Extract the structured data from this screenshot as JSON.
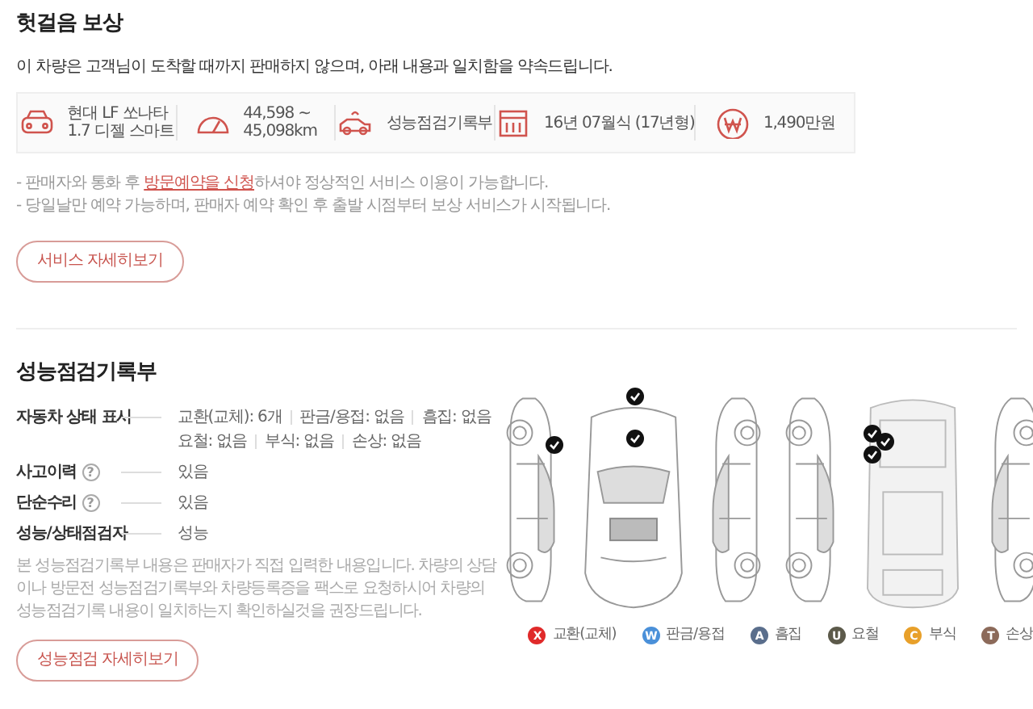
{
  "compensation": {
    "title": "헛걸음 보상",
    "intro": "이 차량은 고객님이 도착할 때까지 판매하지 않으며, 아래 내용과 일치함을 약속드립니다.",
    "info": [
      {
        "kind": "car",
        "lines": [
          "현대 LF 쏘나타",
          "1.7 디젤 스마트"
        ]
      },
      {
        "kind": "gauge",
        "lines": [
          "44,598 ~",
          "45,098km"
        ]
      },
      {
        "kind": "record",
        "lines": [
          "성능점검기록부"
        ]
      },
      {
        "kind": "calendar",
        "lines": [
          "16년 07월식 (17년형)"
        ]
      },
      {
        "kind": "price",
        "lines": [
          "1,490만원"
        ]
      }
    ],
    "notes": [
      {
        "before": "- 판매자와 통화 후 ",
        "link": "방문예약을 신청",
        "after": "하셔야 정상적인 서비스 이용이 가능합니다."
      },
      {
        "before": "- 당일날만 예약 가능하며, 판매자 예약 확인 후 출발 시점부터 보상 서비스가 시작됩니다."
      }
    ],
    "button": "서비스 자세히보기"
  },
  "inspection": {
    "title": "성능점검기록부",
    "rows": [
      {
        "label": "자동차 상태 표시",
        "help": false,
        "values": [
          [
            "교환(교체): 6개",
            "판금/용접: 없음",
            "흠집: 없음"
          ],
          [
            "요철: 없음",
            "부식: 없음",
            "손상: 없음"
          ]
        ]
      },
      {
        "label": "사고이력",
        "help": true,
        "values": [
          [
            "있음"
          ]
        ]
      },
      {
        "label": "단순수리",
        "help": true,
        "values": [
          [
            "있음"
          ]
        ]
      },
      {
        "label": "성능/상태점검자",
        "help": false,
        "values": [
          [
            "성능"
          ]
        ]
      }
    ],
    "note": "본 성능점검기록부 내용은 판매자가 직접 입력한 내용입니다. 차량의 상담이나 방문전 성능점검기록부와 차량등록증을 팩스로 요청하시어 차량의 성능점검기록 내용이 일치하는지 확인하실것을 권장드립니다.",
    "button": "성능점검 자세히보기",
    "help_mark": "?",
    "legend": [
      {
        "letter": "X",
        "label": "교환(교체)",
        "color": "#e02a2a"
      },
      {
        "letter": "W",
        "label": "판금/용접",
        "color": "#4a90d9"
      },
      {
        "letter": "A",
        "label": "흠집",
        "color": "#5a6e8c"
      },
      {
        "letter": "U",
        "label": "요철",
        "color": "#5c5a4a"
      },
      {
        "letter": "C",
        "label": "부식",
        "color": "#e8a02a"
      },
      {
        "letter": "T",
        "label": "손상",
        "color": "#8c6a5a"
      }
    ]
  }
}
